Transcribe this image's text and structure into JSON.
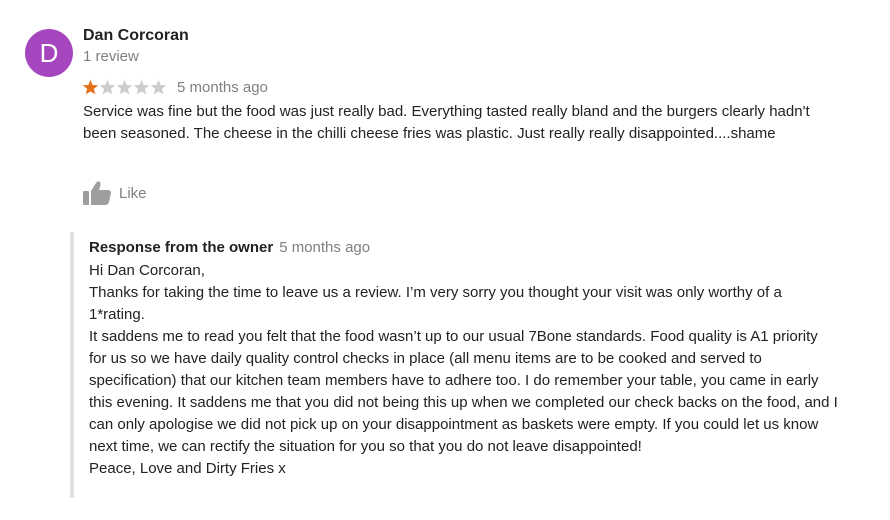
{
  "colors": {
    "avatar_bg": "#a546be",
    "star_filled": "#e7711b",
    "star_empty": "#cccccc",
    "muted_text": "#808080",
    "response_bar": "#e0e0e0"
  },
  "review": {
    "avatar_letter": "D",
    "reviewer_name": "Dan Corcoran",
    "review_count": "1 review",
    "rating": 1,
    "max_rating": 5,
    "time": "5 months ago",
    "text": "Service was fine but the food was just really bad. Everything tasted really bland and the burgers clearly hadn't been seasoned. The cheese in the chilli cheese fries was plastic. Just really really disappointed....shame",
    "like_label": "Like",
    "like_icon": "thumbs-up-icon"
  },
  "owner_response": {
    "title": "Response from the owner",
    "time": "5 months ago",
    "greeting": "Hi Dan Corcoran,",
    "paragraph_1": "Thanks for taking the time to leave us a review. I’m very sorry you thought your visit was only worthy of a 1*rating.",
    "paragraph_2": "It saddens me to read you felt that the food wasn’t up to our usual 7Bone standards. Food quality is A1 priority for us so we have daily quality control checks in place (all menu items are to be cooked and served to specification) that our kitchen team members have to adhere too. I do remember your table, you came in early this evening. It saddens me that you did not being this up when we completed our check backs on the food, and I can only apologise we did not pick up on your disappointment as baskets were empty. If you could let us know next time, we can rectify the situation for you so that you do not leave disappointed!",
    "signoff": "Peace, Love and Dirty Fries x"
  }
}
